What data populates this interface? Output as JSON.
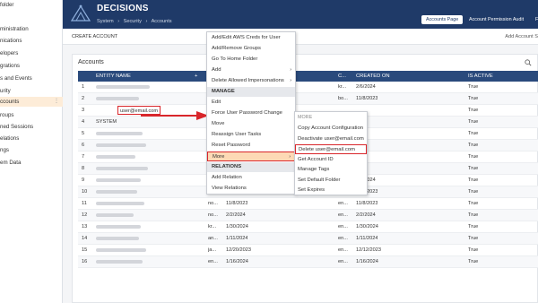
{
  "sidebar": {
    "items": [
      {
        "label": "folder"
      },
      {
        "label": "ministration"
      },
      {
        "label": "nications"
      },
      {
        "label": "elopers"
      },
      {
        "label": "grations"
      },
      {
        "label": "s and Events"
      },
      {
        "label": "urity"
      },
      {
        "label": "ccounts"
      },
      {
        "label": "roups"
      },
      {
        "label": "ned Sessions"
      },
      {
        "label": "elations"
      },
      {
        "label": "ngs"
      },
      {
        "label": "em Data"
      }
    ],
    "active_index": 7
  },
  "header": {
    "title": "DECISIONS",
    "breadcrumb": [
      "System",
      "›",
      "Security",
      "›",
      "Accounts"
    ],
    "tabs": [
      "Accounts Page",
      "Account Permission Audit",
      "Fo"
    ]
  },
  "toolbar": {
    "create_label": "CREATE ACCOUNT",
    "add_label": "Add Account S"
  },
  "panel": {
    "title": "Accounts",
    "columns": {
      "entity": "ENTITY NAME",
      "plus": "+",
      "c": "C...",
      "created": "CREATED ON",
      "active": "IS ACTIVE"
    },
    "rows": [
      {
        "num": "1",
        "name": "",
        "x": "",
        "date1": "",
        "c": "kr...",
        "created": "2/6/2024",
        "active": "True"
      },
      {
        "num": "2",
        "name": "",
        "x": "",
        "date1": "",
        "c": "bo...",
        "created": "11/8/2023",
        "active": "True"
      },
      {
        "num": "3",
        "name": "user@email.com",
        "x": "",
        "date1": "",
        "c": "",
        "created": "",
        "active": "True"
      },
      {
        "num": "4",
        "name": "SYSTEM",
        "x": "",
        "date1": "",
        "c": "",
        "created": "",
        "active": "True"
      },
      {
        "num": "5",
        "name": "",
        "x": "",
        "date1": "",
        "c": "",
        "created": "",
        "active": "True"
      },
      {
        "num": "6",
        "name": "",
        "x": "",
        "date1": "",
        "c": "",
        "created": "",
        "active": "True"
      },
      {
        "num": "7",
        "name": "",
        "x": "",
        "date1": "",
        "c": "",
        "created": "",
        "active": "True"
      },
      {
        "num": "8",
        "name": "",
        "x": "",
        "date1": "",
        "c": "",
        "created": "",
        "active": "True"
      },
      {
        "num": "9",
        "name": "",
        "x": "",
        "date1": "",
        "c": "",
        "created": "2/2/2024",
        "active": "True"
      },
      {
        "num": "10",
        "name": "",
        "x": "...",
        "date1": "11/3/2023",
        "c": "SY...",
        "created": "11/3/2023",
        "active": "True"
      },
      {
        "num": "11",
        "name": "",
        "x": "no...",
        "date1": "11/8/2023",
        "c": "en...",
        "created": "11/8/2023",
        "active": "True"
      },
      {
        "num": "12",
        "name": "",
        "x": "no...",
        "date1": "2/2/2024",
        "c": "en...",
        "created": "2/2/2024",
        "active": "True"
      },
      {
        "num": "13",
        "name": "",
        "x": "kr...",
        "date1": "1/30/2024",
        "c": "en...",
        "created": "1/30/2024",
        "active": "True"
      },
      {
        "num": "14",
        "name": "",
        "x": "an...",
        "date1": "1/11/2024",
        "c": "en...",
        "created": "1/11/2024",
        "active": "True"
      },
      {
        "num": "15",
        "name": "",
        "x": "ja...",
        "date1": "12/20/2023",
        "c": "en...",
        "created": "12/12/2023",
        "active": "True"
      },
      {
        "num": "16",
        "name": "",
        "x": "en...",
        "date1": "1/16/2024",
        "c": "en...",
        "created": "1/16/2024",
        "active": "True"
      }
    ]
  },
  "context_menu": {
    "items": [
      {
        "type": "item",
        "label": "Add/Edit AWS Creds for User"
      },
      {
        "type": "item",
        "label": "Add/Remove Groups"
      },
      {
        "type": "item",
        "label": "Go To Home Folder"
      },
      {
        "type": "item",
        "label": "Add",
        "arrow": "›"
      },
      {
        "type": "item",
        "label": "Delete Allowed Impersonations",
        "arrow": "›"
      },
      {
        "type": "header",
        "label": "MANAGE"
      },
      {
        "type": "item",
        "label": "Edit"
      },
      {
        "type": "item",
        "label": "Force User Password Change"
      },
      {
        "type": "item",
        "label": "Move"
      },
      {
        "type": "item",
        "label": "Reassign User Tasks"
      },
      {
        "type": "item",
        "label": "Reset Password"
      },
      {
        "type": "item",
        "label": "More",
        "arrow": "›"
      },
      {
        "type": "header",
        "label": "RELATIONS"
      },
      {
        "type": "item",
        "label": "Add Relation"
      },
      {
        "type": "item",
        "label": "View Relations"
      }
    ]
  },
  "sub_menu": {
    "header": "MORE",
    "items": [
      "Copy Account Configuration",
      "Deactivate user@email.com",
      "Delete user@email.com",
      "Get Account ID",
      "Manage Tags",
      "Set Default Folder",
      "Set Expires"
    ]
  },
  "colors": {
    "header_bg": "#1f3a68",
    "table_head_bg": "#2a4a7c",
    "highlight_red": "#d9262b",
    "menu_more_bg": "#fdd9b5",
    "active_sidebar_bg": "#fdecd8"
  },
  "icons": {
    "logo": "decisions-logo-icon",
    "search": "search-icon",
    "arrow": "red-pointer-arrow"
  }
}
